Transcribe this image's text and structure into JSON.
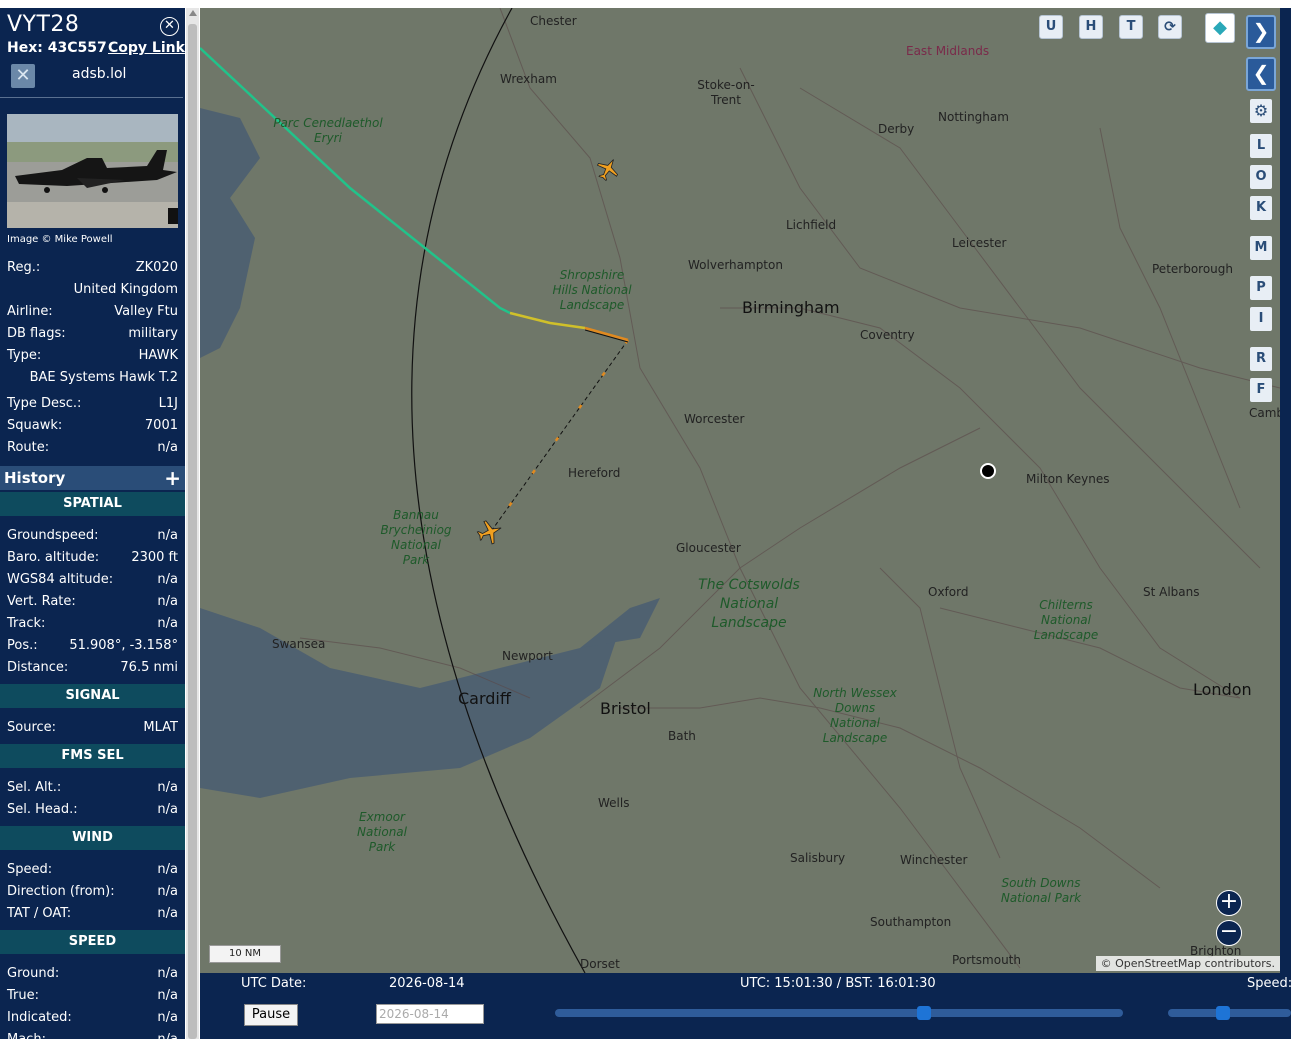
{
  "aircraft": {
    "callsign": "VYT28",
    "hex_label": "Hex:",
    "hex": "43C557",
    "copy_link": "Copy Link",
    "source_site": "adsb.lol",
    "photo_credit": "Image © Mike Powell"
  },
  "info": [
    {
      "label": "Reg.:",
      "value": "ZK020"
    },
    {
      "label": "",
      "value": "United Kingdom"
    },
    {
      "label": "Airline:",
      "value": "Valley Ftu"
    },
    {
      "label": "DB flags:",
      "value": "military"
    },
    {
      "label": "Type:",
      "value": "HAWK"
    },
    {
      "label": "",
      "value": "BAE Systems Hawk T.2"
    },
    {
      "label": "Type Desc.:",
      "value": "L1J"
    },
    {
      "label": "Squawk:",
      "value": "7001"
    },
    {
      "label": "Route:",
      "value": "n/a"
    }
  ],
  "history": {
    "label": "History",
    "expand": "+"
  },
  "sections": {
    "spatial": "SPATIAL",
    "signal": "SIGNAL",
    "fms": "FMS SEL",
    "wind": "WIND",
    "speed": "SPEED"
  },
  "spatial": [
    {
      "label": "Groundspeed:",
      "value": "n/a"
    },
    {
      "label": "Baro. altitude:",
      "value": "2300 ft"
    },
    {
      "label": "WGS84 altitude:",
      "value": "n/a"
    },
    {
      "label": "Vert. Rate:",
      "value": "n/a"
    },
    {
      "label": "Track:",
      "value": "n/a"
    },
    {
      "label": "Pos.:",
      "value": "51.908°, -3.158°"
    },
    {
      "label": "Distance:",
      "value": "76.5 nmi"
    }
  ],
  "signal": [
    {
      "label": "Source:",
      "value": "MLAT"
    }
  ],
  "fms": [
    {
      "label": "Sel. Alt.:",
      "value": "n/a"
    },
    {
      "label": "Sel. Head.:",
      "value": "n/a"
    }
  ],
  "wind": [
    {
      "label": "Speed:",
      "value": "n/a"
    },
    {
      "label": "Direction (from):",
      "value": "n/a"
    },
    {
      "label": "TAT / OAT:",
      "value": "n/a"
    }
  ],
  "speed": [
    {
      "label": "Ground:",
      "value": "n/a"
    },
    {
      "label": "True:",
      "value": "n/a"
    },
    {
      "label": "Indicated:",
      "value": "n/a"
    },
    {
      "label": "Mach:",
      "value": "n/a"
    }
  ],
  "map": {
    "places": [
      "Chester",
      "Wrexham",
      "Stoke-on-Trent",
      "East Midlands",
      "Nottingham",
      "Derby",
      "Lichfield",
      "Leicester",
      "Peterborough",
      "Wolverhampton",
      "Birmingham",
      "Coventry",
      "Worcester",
      "Hereford",
      "Milton Keynes",
      "Gloucester",
      "Oxford",
      "St Albans",
      "Swansea",
      "Newport",
      "Cardiff",
      "Bristol",
      "Bath",
      "London",
      "Wells",
      "Salisbury",
      "Winchester",
      "Southampton",
      "Portsmouth",
      "Brighton",
      "Dorset",
      "Camb"
    ],
    "parks": [
      "Parc Cenedlaethol Eryri",
      "Shropshire Hills National Landscape",
      "Bannau Brycheiniog National Park",
      "The Cotswolds National Landscape",
      "Chilterns National Landscape",
      "North Wessex Downs National Landscape",
      "Exmoor National Park",
      "South Downs National Park"
    ],
    "scale": "10 NM",
    "attribution": "© OpenStreetMap contributors.",
    "toolbar": [
      "U",
      "H",
      "T"
    ],
    "side_buttons": [
      "L",
      "O",
      "K",
      "M",
      "P",
      "I",
      "R",
      "F"
    ],
    "zoom_in": "+",
    "zoom_out": "−"
  },
  "bottom": {
    "utc_date_label": "UTC Date:",
    "utc_date": "2026-08-14",
    "clock": "UTC: 15:01:30 / BST: 16:01:30",
    "speed_label": "Speed:",
    "pause": "Pause",
    "date_input": "2026-08-14",
    "playback_position": 0.65,
    "speed_position": 0.45
  }
}
